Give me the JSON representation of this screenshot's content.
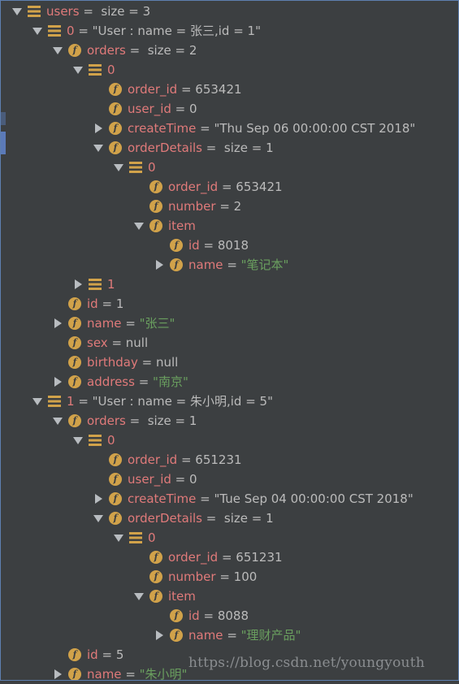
{
  "watermark": "https://blog.csdn.net/youngyouth",
  "tree": [
    {
      "level": 0,
      "toggle": "down",
      "icon": "list",
      "name": "users",
      "sep": " = ",
      "value": " size = 3",
      "kind": "plain"
    },
    {
      "level": 1,
      "toggle": "down",
      "icon": "list",
      "name": "0",
      "sep": " = ",
      "value": "\"User : name = 张三,id = 1\"",
      "kind": "obj"
    },
    {
      "level": 2,
      "toggle": "down",
      "icon": "field",
      "name": "orders",
      "sep": " = ",
      "value": " size = 2",
      "kind": "plain"
    },
    {
      "level": 3,
      "toggle": "down",
      "icon": "list",
      "name": "0",
      "sep": "",
      "value": "",
      "kind": "plain"
    },
    {
      "level": 4,
      "toggle": "none",
      "icon": "field",
      "name": "order_id",
      "sep": " = ",
      "value": "653421",
      "kind": "plain"
    },
    {
      "level": 4,
      "toggle": "none",
      "icon": "field",
      "name": "user_id",
      "sep": " = ",
      "value": "0",
      "kind": "plain"
    },
    {
      "level": 4,
      "toggle": "right",
      "icon": "field",
      "name": "createTime",
      "sep": " = ",
      "value": "\"Thu Sep 06 00:00:00 CST 2018\"",
      "kind": "obj"
    },
    {
      "level": 4,
      "toggle": "down",
      "icon": "field",
      "name": "orderDetails",
      "sep": " = ",
      "value": " size = 1",
      "kind": "plain"
    },
    {
      "level": 5,
      "toggle": "down",
      "icon": "list",
      "name": "0",
      "sep": "",
      "value": "",
      "kind": "plain"
    },
    {
      "level": 6,
      "toggle": "none",
      "icon": "field",
      "name": "order_id",
      "sep": " = ",
      "value": "653421",
      "kind": "plain"
    },
    {
      "level": 6,
      "toggle": "none",
      "icon": "field",
      "name": "number",
      "sep": " = ",
      "value": "2",
      "kind": "plain"
    },
    {
      "level": 6,
      "toggle": "down",
      "icon": "field",
      "name": "item",
      "sep": "",
      "value": "",
      "kind": "plain"
    },
    {
      "level": 7,
      "toggle": "none",
      "icon": "field",
      "name": "id",
      "sep": " = ",
      "value": "8018",
      "kind": "plain"
    },
    {
      "level": 7,
      "toggle": "right",
      "icon": "field",
      "name": "name",
      "sep": " = ",
      "value": "\"笔记本\"",
      "kind": "str"
    },
    {
      "level": 3,
      "toggle": "right",
      "icon": "list",
      "name": "1",
      "sep": "",
      "value": "",
      "kind": "plain"
    },
    {
      "level": 2,
      "toggle": "none",
      "icon": "field",
      "name": "id",
      "sep": " = ",
      "value": "1",
      "kind": "plain"
    },
    {
      "level": 2,
      "toggle": "right",
      "icon": "field",
      "name": "name",
      "sep": " = ",
      "value": "\"张三\"",
      "kind": "str"
    },
    {
      "level": 2,
      "toggle": "none",
      "icon": "field",
      "name": "sex",
      "sep": " = ",
      "value": "null",
      "kind": "plain"
    },
    {
      "level": 2,
      "toggle": "none",
      "icon": "field",
      "name": "birthday",
      "sep": " = ",
      "value": "null",
      "kind": "plain"
    },
    {
      "level": 2,
      "toggle": "right",
      "icon": "field",
      "name": "address",
      "sep": " = ",
      "value": "\"南京\"",
      "kind": "str"
    },
    {
      "level": 1,
      "toggle": "down",
      "icon": "list",
      "name": "1",
      "sep": " = ",
      "value": "\"User : name = 朱小明,id = 5\"",
      "kind": "obj"
    },
    {
      "level": 2,
      "toggle": "down",
      "icon": "field",
      "name": "orders",
      "sep": " = ",
      "value": " size = 1",
      "kind": "plain"
    },
    {
      "level": 3,
      "toggle": "down",
      "icon": "list",
      "name": "0",
      "sep": "",
      "value": "",
      "kind": "plain"
    },
    {
      "level": 4,
      "toggle": "none",
      "icon": "field",
      "name": "order_id",
      "sep": " = ",
      "value": "651231",
      "kind": "plain"
    },
    {
      "level": 4,
      "toggle": "none",
      "icon": "field",
      "name": "user_id",
      "sep": " = ",
      "value": "0",
      "kind": "plain"
    },
    {
      "level": 4,
      "toggle": "right",
      "icon": "field",
      "name": "createTime",
      "sep": " = ",
      "value": "\"Tue Sep 04 00:00:00 CST 2018\"",
      "kind": "obj"
    },
    {
      "level": 4,
      "toggle": "down",
      "icon": "field",
      "name": "orderDetails",
      "sep": " = ",
      "value": " size = 1",
      "kind": "plain"
    },
    {
      "level": 5,
      "toggle": "down",
      "icon": "list",
      "name": "0",
      "sep": "",
      "value": "",
      "kind": "plain"
    },
    {
      "level": 6,
      "toggle": "none",
      "icon": "field",
      "name": "order_id",
      "sep": " = ",
      "value": "651231",
      "kind": "plain"
    },
    {
      "level": 6,
      "toggle": "none",
      "icon": "field",
      "name": "number",
      "sep": " = ",
      "value": "100",
      "kind": "plain"
    },
    {
      "level": 6,
      "toggle": "down",
      "icon": "field",
      "name": "item",
      "sep": "",
      "value": "",
      "kind": "plain"
    },
    {
      "level": 7,
      "toggle": "none",
      "icon": "field",
      "name": "id",
      "sep": " = ",
      "value": "8088",
      "kind": "plain"
    },
    {
      "level": 7,
      "toggle": "right",
      "icon": "field",
      "name": "name",
      "sep": " = ",
      "value": "\"理财产品\"",
      "kind": "str"
    },
    {
      "level": 2,
      "toggle": "none",
      "icon": "field",
      "name": "id",
      "sep": " = ",
      "value": "5",
      "kind": "plain"
    },
    {
      "level": 2,
      "toggle": "right",
      "icon": "field",
      "name": "name",
      "sep": " = ",
      "value": "\"朱小明\"",
      "kind": "str"
    }
  ],
  "icons": {
    "list": "list-icon",
    "field": "field-icon",
    "field_glyph": "f"
  },
  "colors": {
    "background": "#3c3f41",
    "name": "#e07a7a",
    "value": "#bbbbbb",
    "string": "#6a9f5f",
    "field_icon": "#d1a24a"
  }
}
